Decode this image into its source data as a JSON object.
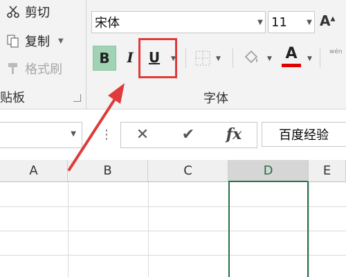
{
  "clipboard": {
    "cut_label": "剪切",
    "copy_label": "复制",
    "format_painter_label": "格式刷",
    "group_label": "贴板"
  },
  "font": {
    "font_name": "宋体",
    "font_size": "11",
    "group_label": "字体",
    "bold_label": "B",
    "italic_label": "I",
    "underline_label": "U",
    "font_color_label": "A",
    "grow_font_label": "A",
    "phonetic_label": "wén"
  },
  "formula_bar": {
    "cancel_symbol": "✕",
    "enter_symbol": "✔",
    "fx_label": "fx",
    "content": "百度经验"
  },
  "grid": {
    "columns": [
      "A",
      "B",
      "C",
      "D",
      "E"
    ],
    "selected_column": "D"
  },
  "colors": {
    "accent_green": "#217346",
    "bold_active_bg": "#9fd3b3",
    "highlight_red": "#e03a3a",
    "font_color_bar": "#e00000"
  },
  "icons": [
    "scissors-icon",
    "copy-icon",
    "format-painter-icon",
    "fill-color-icon",
    "border-icon",
    "dialog-launcher-icon"
  ]
}
